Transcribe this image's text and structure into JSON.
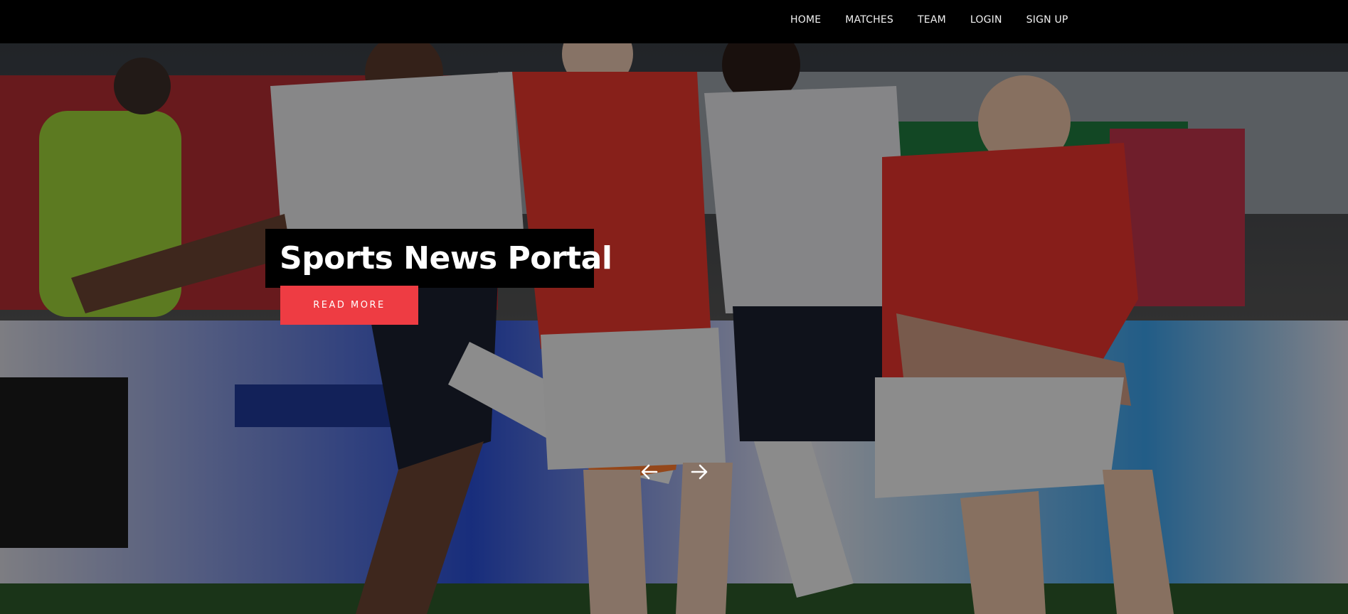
{
  "nav": {
    "items": [
      {
        "label": "HOME"
      },
      {
        "label": "MATCHES"
      },
      {
        "label": "TEAM"
      },
      {
        "label": "LOGIN"
      },
      {
        "label": "SIGN UP"
      }
    ]
  },
  "hero": {
    "title": "Sports News Portal",
    "button_label": "READ MORE",
    "image_semantic": "football-match-photo"
  },
  "carousel": {
    "prev_icon": "arrow-left-icon",
    "next_icon": "arrow-right-icon"
  },
  "colors": {
    "navbar_bg": "#000000",
    "accent": "#ee3c43",
    "caption_bg": "#000000",
    "text": "#ffffff"
  }
}
